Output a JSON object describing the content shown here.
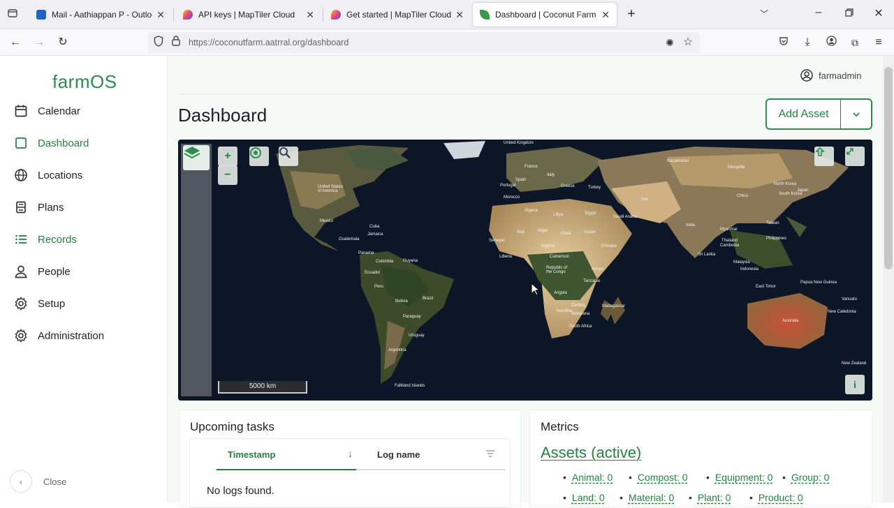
{
  "browser": {
    "tabs": [
      {
        "title": "Mail - Aathiappan P - Outlook",
        "color": "#1e63c5"
      },
      {
        "title": "API keys | MapTiler Cloud",
        "color": "#e04c7a"
      },
      {
        "title": "Get started | MapTiler Cloud",
        "color": "#e04c7a"
      },
      {
        "title": "Dashboard | Coconut Farm",
        "color": "#3a9a4a"
      }
    ],
    "url": "https://coconutfarm.aatrral.org/dashboard"
  },
  "sidebar": {
    "brand": "farmOS",
    "items": [
      {
        "label": "Calendar",
        "icon": "calendar-icon"
      },
      {
        "label": "Dashboard",
        "icon": "square-icon"
      },
      {
        "label": "Locations",
        "icon": "globe-icon"
      },
      {
        "label": "Plans",
        "icon": "clipboard-icon"
      },
      {
        "label": "Records",
        "icon": "list-icon"
      },
      {
        "label": "People",
        "icon": "person-icon"
      },
      {
        "label": "Setup",
        "icon": "gear-icon"
      },
      {
        "label": "Administration",
        "icon": "gear-icon"
      }
    ],
    "close_label": "Close"
  },
  "header": {
    "username": "farmadmin",
    "title": "Dashboard",
    "add_asset_label": "Add Asset"
  },
  "map": {
    "scale_label": "5000 km",
    "labels": {
      "north_america": "United States of America",
      "mexico": "Mexico",
      "guatemala": "Guatemala",
      "cuba": "Cuba",
      "jamaica": "Jamaica",
      "panama": "Panama",
      "colombia": "Colombia",
      "guyana": "Guyana",
      "ecuador": "Ecuador",
      "peru": "Peru",
      "bolivia": "Bolivia",
      "brazil": "Brazil",
      "paraguay": "Paraguay",
      "uruguay": "Uruguay",
      "argentina": "Argentina",
      "falkland": "Falkland Islands",
      "uk": "United Kingdom",
      "france": "France",
      "spain": "Spain",
      "portugal": "Portugal",
      "italy": "Italy",
      "greece": "Greece",
      "turkey": "Turkey",
      "morocco": "Morocco",
      "algeria": "Algeria",
      "libya": "Libya",
      "egypt": "Egypt",
      "mali": "Mali",
      "niger": "Niger",
      "chad": "Chad",
      "sudan": "Sudan",
      "ethiopia": "Ethiopia",
      "nigeria": "Nigeria",
      "senegal": "Senegal",
      "cameroon": "Cameroon",
      "liberia": "Liberia",
      "congo": "Republic of the Congo",
      "kenya": "Kenya",
      "tanzania": "Tanzania",
      "angola": "Angola",
      "zambia": "Zambia",
      "namibia": "Namibia",
      "botswana": "Botswana",
      "south_africa": "South Africa",
      "madagascar": "Madagascar",
      "saudi": "Saudi Arabia",
      "iran": "Iran",
      "kazakhstan": "Kazakhstan",
      "mongolia": "Mongolia",
      "china": "China",
      "india": "India",
      "myanmar": "Myanmar",
      "thailand": "Thailand",
      "cambodia": "Cambodia",
      "philippines": "Philippines",
      "sri_lanka": "Sri Lanka",
      "malaysia": "Malaysia",
      "indonesia": "Indonesia",
      "east_timor": "East Timor",
      "png": "Papua New Guinea",
      "australia": "Australia",
      "north_korea": "North Korea",
      "south_korea": "South Korea",
      "japan": "Japan",
      "taiwan": "Taiwan",
      "vanuatu": "Vanuatu",
      "new_caledonia": "New Caledonia",
      "new_zealand": "New Zealand"
    }
  },
  "tasks": {
    "title": "Upcoming tasks",
    "columns": [
      "Timestamp",
      "Log name"
    ],
    "empty_message": "No logs found."
  },
  "metrics": {
    "title": "Metrics",
    "subtitle": "Assets (active)",
    "items": [
      "Animal: 0",
      "Compost: 0",
      "Equipment: 0",
      "Group: 0",
      "Land: 0",
      "Material: 0",
      "Plant: 0",
      "Product: 0"
    ]
  }
}
